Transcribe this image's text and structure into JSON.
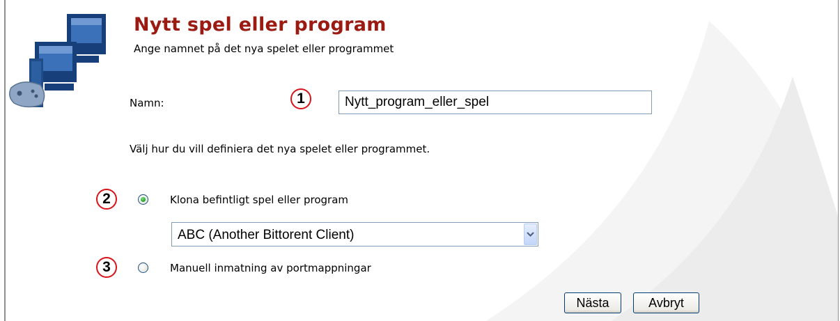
{
  "header": {
    "title": "Nytt spel eller program",
    "subtitle": "Ange namnet på det nya spelet eller programmet"
  },
  "form": {
    "name_label": "Namn:",
    "name_value": "Nytt_program_eller_spel",
    "instruction": "Välj hur du vill definiera det nya spelet eller programmet.",
    "options": [
      {
        "label": "Klona befintligt spel eller program",
        "selected": true
      },
      {
        "label": "Manuell inmatning av portmappningar",
        "selected": false
      }
    ],
    "clone_select_value": "ABC (Another Bittorent Client)"
  },
  "badges": [
    "1",
    "2",
    "3"
  ],
  "buttons": {
    "next": "Nästa",
    "cancel": "Avbryt"
  },
  "colors": {
    "title": "#9b1a12",
    "badge_ring": "#d8141a",
    "radio_checked": "#2aa62a",
    "logo_blue": "#173f7a"
  },
  "icons": [
    "computer-gamepad-logo-icon",
    "chevron-down-icon"
  ]
}
